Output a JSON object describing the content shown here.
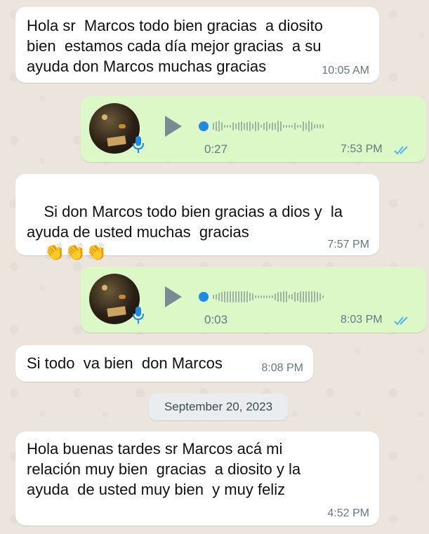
{
  "messages": [
    {
      "text": "Hola sr  Marcos todo bien gracias  a diosito\nbien  estamos cada día mejor gracias  a su\nayuda don Marcos muchas gracias",
      "time": "10:05 AM"
    },
    {
      "duration": "0:27",
      "time": "7:53 PM"
    },
    {
      "text": "Si don Marcos todo bien gracias a dios y  la\nayuda de usted muchas  gracias",
      "emoji": "👏👏👏",
      "time": "7:57 PM"
    },
    {
      "duration": "0:03",
      "time": "8:03 PM"
    },
    {
      "text": "Si todo  va bien  don Marcos",
      "time": "8:08 PM"
    },
    {
      "text": "Hola buenas tardes sr Marcos acá mi\nrelación muy bien  gracias  a diosito y la\nayuda  de usted muy bien  y muy feliz",
      "time": "4:52 PM"
    }
  ],
  "date_separator": "September 20, 2023",
  "icons": {
    "play": "play-icon",
    "mic": "microphone-icon",
    "ticks": "double-check-icon",
    "avatar": "avatar"
  },
  "colors": {
    "incoming": "#ffffff",
    "outgoing": "#dcf8c6",
    "tick_read": "#4fb6ec",
    "progress_knob": "#1e8ae6"
  },
  "audio_progress": [
    0,
    0
  ]
}
